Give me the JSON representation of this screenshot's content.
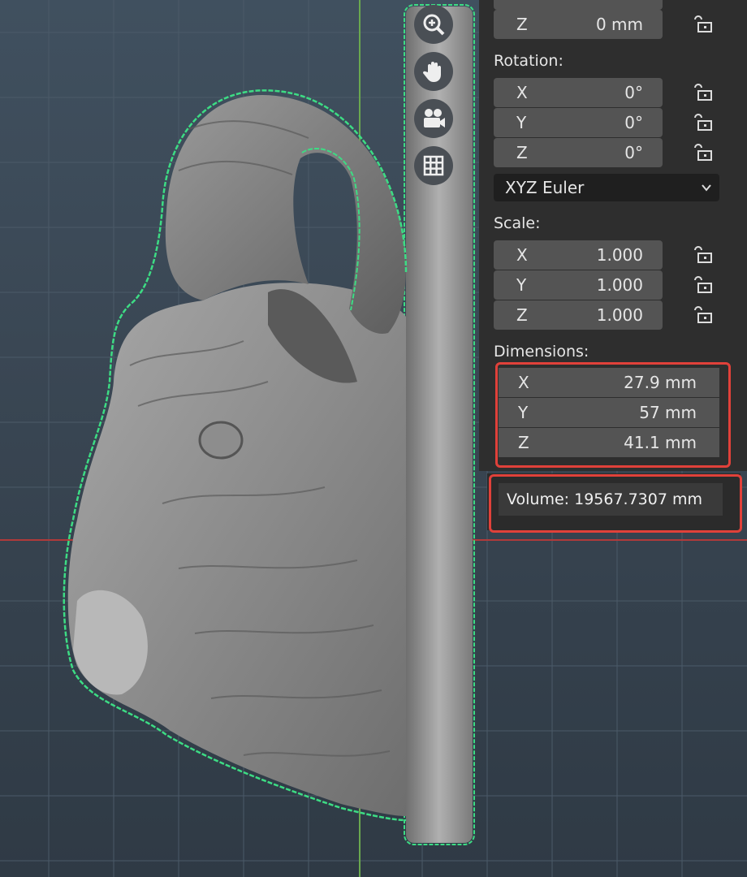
{
  "navigation_gizmo": {
    "buttons": [
      {
        "name": "zoom-icon"
      },
      {
        "name": "hand-pan-icon"
      },
      {
        "name": "camera-icon"
      },
      {
        "name": "grid-icon"
      }
    ]
  },
  "transform_panel": {
    "location_z": {
      "axis": "Z",
      "value": "0 mm"
    },
    "rotation": {
      "label": "Rotation:",
      "x": {
        "axis": "X",
        "value": "0°"
      },
      "y": {
        "axis": "Y",
        "value": "0°"
      },
      "z": {
        "axis": "Z",
        "value": "0°"
      },
      "mode": "XYZ Euler"
    },
    "scale": {
      "label": "Scale:",
      "x": {
        "axis": "X",
        "value": "1.000"
      },
      "y": {
        "axis": "Y",
        "value": "1.000"
      },
      "z": {
        "axis": "Z",
        "value": "1.000"
      }
    },
    "dimensions": {
      "label": "Dimensions:",
      "x": {
        "axis": "X",
        "value": "27.9 mm"
      },
      "y": {
        "axis": "Y",
        "value": "57 mm"
      },
      "z": {
        "axis": "Z",
        "value": "41.1 mm"
      }
    }
  },
  "volume_text": "Volume: 19567.7307 mm",
  "colors": {
    "selection_outline": "#3ddc84",
    "highlight_box": "#e0413a",
    "x_axis_line": "#b03a3a",
    "y_axis_line": "#6aa84f"
  }
}
